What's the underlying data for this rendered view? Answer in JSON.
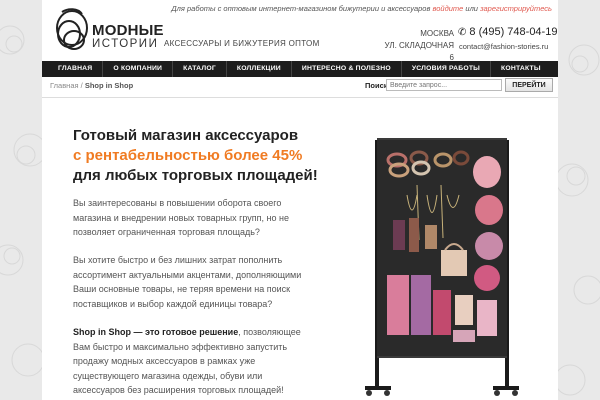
{
  "header": {
    "topline_text": "Для работы с оптовым интернет-магазином бижутерии и аксессуаров",
    "login_link": "войдите",
    "or_text": "или",
    "register_link": "зарегистрируйтесь",
    "brand_line1": "MODHЫE",
    "brand_line2": "ИСТОРИИ",
    "tagline": "АКСЕССУАРЫ И БИЖУТЕРИЯ ОПТОМ",
    "city": "МОСКВА",
    "address": "УЛ. СКЛАДОЧНАЯ 6",
    "phone": "8 (495) 748-04-19",
    "email": "contact@fashion-stories.ru"
  },
  "nav": {
    "items": [
      {
        "label": "ГЛАВНАЯ"
      },
      {
        "label": "О КОМПАНИИ"
      },
      {
        "label": "КАТАЛОГ"
      },
      {
        "label": "КОЛЛЕКЦИИ"
      },
      {
        "label": "ИНТЕРЕСНО & ПОЛЕЗНО"
      },
      {
        "label": "УСЛОВИЯ РАБОТЫ"
      },
      {
        "label": "КОНТАКТЫ"
      }
    ]
  },
  "breadcrumb": {
    "home": "Главная",
    "separator": "/",
    "current": "Shop in Shop"
  },
  "search": {
    "label": "Поиск",
    "placeholder": "Введите запрос...",
    "button": "ПЕРЕЙТИ"
  },
  "content": {
    "headline_1": "Готовый магазин аксессуаров",
    "headline_2": "с рентабельностью более 45%",
    "headline_3": "для любых торговых площадей!",
    "para1": "Вы заинтересованы в повышении оборота своего магазина и внедрении новых товарных групп, но не позволяет ограниченная торговая площадь?",
    "para2": "Вы хотите быстро и без лишних затрат пополнить ассортимент актуальными акцентами, дополняющими Ваши основные товары, не теряя времени на поиск поставщиков и выбор каждой единицы товара?",
    "para3_bold": "Shop in Shop — это готовое решение",
    "para3_rest": ", позволяющее Вам быстро и максимально эффективно запустить продажу модных аксессуаров в рамках уже существующего магазина одежды, обуви или аксессуаров без расширения торговых площадей!"
  },
  "colors": {
    "accent_orange": "#f07b22",
    "link_red": "#e0584e",
    "nav_bg": "#1d1d1d"
  },
  "icons": {
    "logo": "rings-logo-icon",
    "phone": "phone-icon"
  }
}
